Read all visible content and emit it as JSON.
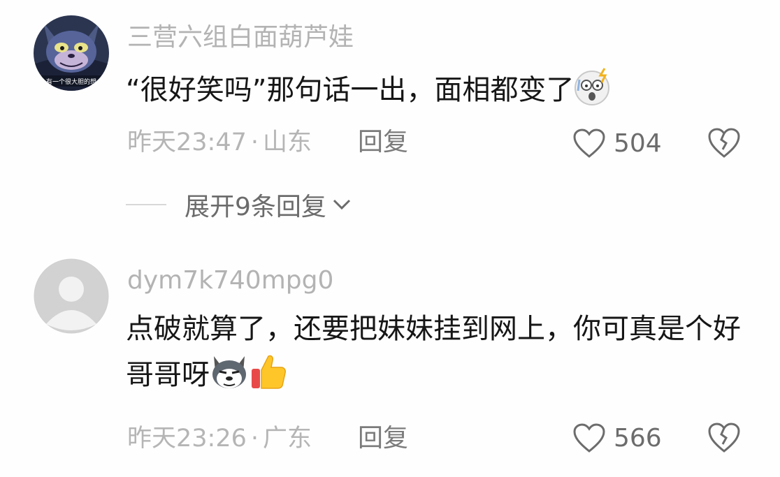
{
  "comments": [
    {
      "username": "三营六组白面葫芦娃",
      "text": "“很好笑吗”那句话一出，面相都变了",
      "emojis": [
        "shocked-face-emoji"
      ],
      "time": "昨天23:47",
      "separator": "·",
      "location": "山东",
      "reply_label": "回复",
      "likes": "504",
      "avatar_caption": "有一个很大胆的想"
    },
    {
      "username": "dym7k740mpg0",
      "text": "点破就算了，还要把妹妹挂到网上，你可真是个好哥哥呀",
      "emojis": [
        "husky-face-emoji",
        "thumbs-up-emoji"
      ],
      "time": "昨天23:26",
      "separator": "·",
      "location": "广东",
      "reply_label": "回复",
      "likes": "566"
    }
  ],
  "expand_replies": {
    "label": "展开9条回复"
  },
  "colors": {
    "username": "#b3b3b3",
    "text": "#161616",
    "meta": "#b5b5b5",
    "action": "#6c6c6c"
  }
}
